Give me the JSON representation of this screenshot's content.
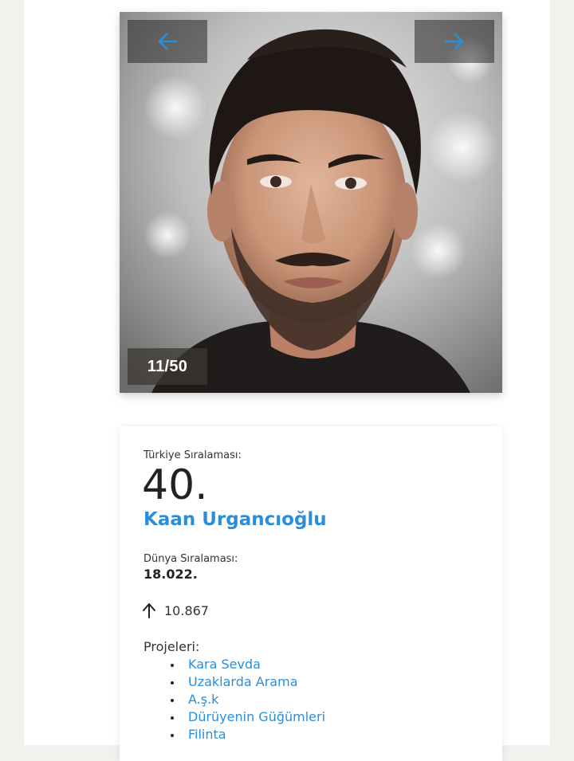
{
  "gallery": {
    "prev_icon": "arrow-left-icon",
    "next_icon": "arrow-right-icon",
    "counter": "11/50",
    "photo": "portrait-photo",
    "accent_color": "#2a8fd8"
  },
  "profile": {
    "turkey_rank_label": "Türkiye Sıralaması:",
    "turkey_rank": "40.",
    "name": "Kaan Urgancıoğlu",
    "world_rank_label": "Dünya Sıralaması:",
    "world_rank": "18.022.",
    "trend_icon": "arrow-up-icon",
    "trend_value": "10.867",
    "projects_label": "Projeleri:",
    "projects": [
      "Kara Sevda",
      "Uzaklarda Arama",
      "A.ş.k",
      "Dürüyenin Güğümleri",
      "Filinta"
    ]
  }
}
